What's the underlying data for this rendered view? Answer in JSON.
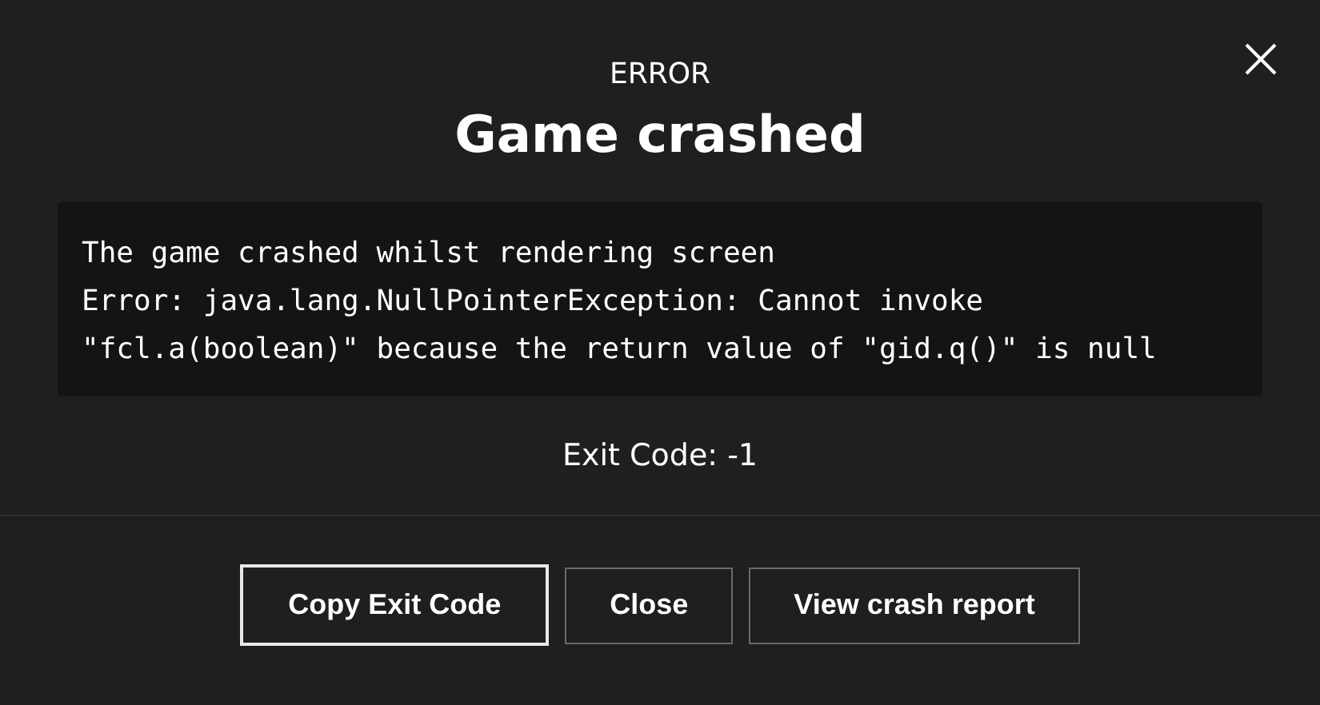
{
  "dialog": {
    "kicker": "ERROR",
    "title": "Game crashed"
  },
  "error_lines": [
    "The game crashed whilst rendering screen",
    "Error: java.lang.NullPointerException: Cannot invoke",
    "\"fcl.a(boolean)\" because the return value of \"gid.q()\" is null"
  ],
  "exit_code": "Exit Code: -1",
  "buttons": [
    {
      "label": "Copy Exit Code",
      "focused": true
    },
    {
      "label": "Close",
      "focused": false
    },
    {
      "label": "View crash report",
      "focused": false
    }
  ]
}
